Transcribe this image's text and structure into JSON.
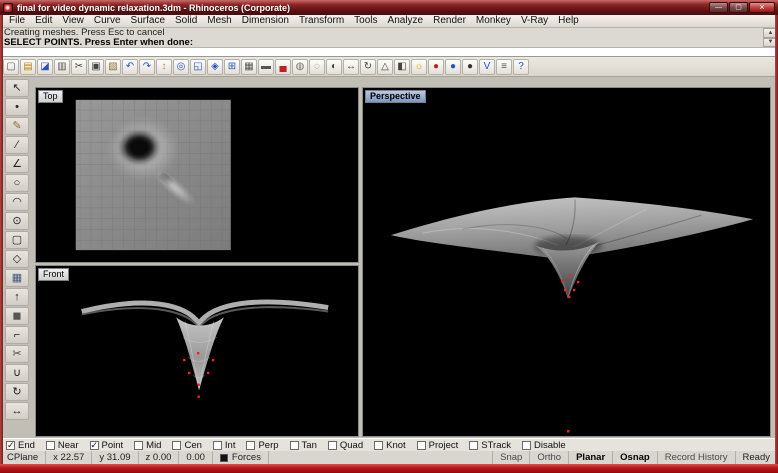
{
  "window": {
    "title": "final for video dynamic relaxation.3dm - Rhinoceros (Corporate)"
  },
  "colors": {
    "title_bar": "#6f1517",
    "frame_red": "#c01818",
    "active_viewport_label": "#8fa7cd",
    "viewport_background": "#000000",
    "control_point_red": "#ff2020"
  },
  "menu": {
    "items": [
      "File",
      "Edit",
      "View",
      "Curve",
      "Surface",
      "Solid",
      "Mesh",
      "Dimension",
      "Transform",
      "Tools",
      "Analyze",
      "Render",
      "Monkey",
      "V-Ray",
      "Help"
    ]
  },
  "command": {
    "history_line_1": "Creating meshes.  Press Esc to cancel",
    "history_line_2": "SELECT POINTS. Press Enter when done:",
    "input_value": ""
  },
  "toolbar": {
    "icons": [
      {
        "name": "new-file-icon",
        "glyph": "▢",
        "color": "#555555"
      },
      {
        "name": "open-file-icon",
        "glyph": "▤",
        "color": "#b8860b"
      },
      {
        "name": "save-icon",
        "glyph": "◪",
        "color": "#2a52be"
      },
      {
        "name": "print-icon",
        "glyph": "▥",
        "color": "#555555"
      },
      {
        "name": "cut-icon",
        "glyph": "✂",
        "color": "#444444"
      },
      {
        "name": "copy-icon",
        "glyph": "▣",
        "color": "#444444"
      },
      {
        "name": "paste-icon",
        "glyph": "▧",
        "color": "#8a6d3b"
      },
      {
        "name": "undo-icon",
        "glyph": "↶",
        "color": "#2a52be"
      },
      {
        "name": "redo-icon",
        "glyph": "↷",
        "color": "#2a52be"
      },
      {
        "name": "pan-icon",
        "glyph": "↕",
        "color": "#c08a50"
      },
      {
        "name": "zoom-dynamic-icon",
        "glyph": "◎",
        "color": "#2a52be"
      },
      {
        "name": "zoom-window-icon",
        "glyph": "◱",
        "color": "#2a52be"
      },
      {
        "name": "zoom-extents-icon",
        "glyph": "◈",
        "color": "#2a52be"
      },
      {
        "name": "zoom-extents-all-icon",
        "glyph": "⊞",
        "color": "#2a52be"
      },
      {
        "name": "viewport-layout-icon",
        "glyph": "▦",
        "color": "#555555"
      },
      {
        "name": "named-views-icon",
        "glyph": "▬",
        "color": "#555555"
      },
      {
        "name": "render-car-icon",
        "glyph": "▄",
        "color": "#c02020"
      },
      {
        "name": "shaded-view-icon",
        "glyph": "◍",
        "color": "#707070"
      },
      {
        "name": "ghosted-view-icon",
        "glyph": "◌",
        "color": "#707070"
      },
      {
        "name": "render-preview-icon",
        "glyph": "◐",
        "color": "#444444"
      },
      {
        "name": "move-icon",
        "glyph": "↔",
        "color": "#444444"
      },
      {
        "name": "rotate-icon",
        "glyph": "↻",
        "color": "#444444"
      },
      {
        "name": "scale-icon",
        "glyph": "△",
        "color": "#444444"
      },
      {
        "name": "mirror-icon",
        "glyph": "◧",
        "color": "#444444"
      },
      {
        "name": "light-icon",
        "glyph": "☼",
        "color": "#d9a800"
      },
      {
        "name": "material-red-icon",
        "glyph": "●",
        "color": "#c22424"
      },
      {
        "name": "material-blue-icon",
        "glyph": "●",
        "color": "#2450c2"
      },
      {
        "name": "material-dark-icon",
        "glyph": "●",
        "color": "#333333"
      },
      {
        "name": "vray-options-icon",
        "glyph": "V",
        "color": "#2450c2"
      },
      {
        "name": "properties-icon",
        "glyph": "≡",
        "color": "#555555"
      },
      {
        "name": "help-icon",
        "glyph": "?",
        "color": "#2450c2"
      }
    ]
  },
  "side_toolbar": {
    "icons": [
      {
        "name": "select-arrow-icon",
        "glyph": "↖",
        "color": "#222222"
      },
      {
        "name": "point-icon",
        "glyph": "•",
        "color": "#222222"
      },
      {
        "name": "curve-pencil-icon",
        "glyph": "✎",
        "color": "#8a6d3b"
      },
      {
        "name": "line-icon",
        "glyph": "∕",
        "color": "#222222"
      },
      {
        "name": "polyline-icon",
        "glyph": "∠",
        "color": "#222222"
      },
      {
        "name": "circle-icon",
        "glyph": "○",
        "color": "#222222"
      },
      {
        "name": "arc-icon",
        "glyph": "◠",
        "color": "#222222"
      },
      {
        "name": "ellipse-icon",
        "glyph": "⊙",
        "color": "#222222"
      },
      {
        "name": "rectangle-icon",
        "glyph": "▢",
        "color": "#222222"
      },
      {
        "name": "polygon-icon",
        "glyph": "◇",
        "color": "#222222"
      },
      {
        "name": "surface-icon",
        "glyph": "▦",
        "color": "#44557a"
      },
      {
        "name": "extrude-icon",
        "glyph": "↑",
        "color": "#222222"
      },
      {
        "name": "solid-box-icon",
        "glyph": "◼",
        "color": "#555555"
      },
      {
        "name": "fillet-icon",
        "glyph": "⌐",
        "color": "#222222"
      },
      {
        "name": "trim-icon",
        "glyph": "✂",
        "color": "#444444"
      },
      {
        "name": "join-icon",
        "glyph": "∪",
        "color": "#222222"
      },
      {
        "name": "transform-icon",
        "glyph": "↻",
        "color": "#222222"
      },
      {
        "name": "dimension-icon",
        "glyph": "↔",
        "color": "#222222"
      }
    ]
  },
  "viewports": {
    "top": {
      "label": "Top"
    },
    "front": {
      "label": "Front"
    },
    "perspective": {
      "label": "Perspective",
      "active": true
    }
  },
  "osnap": {
    "items": [
      {
        "name": "osnap-end",
        "label": "End",
        "checked": true
      },
      {
        "name": "osnap-near",
        "label": "Near",
        "checked": false
      },
      {
        "name": "osnap-point",
        "label": "Point",
        "checked": true
      },
      {
        "name": "osnap-mid",
        "label": "Mid",
        "checked": false
      },
      {
        "name": "osnap-cen",
        "label": "Cen",
        "checked": false
      },
      {
        "name": "osnap-int",
        "label": "Int",
        "checked": false
      },
      {
        "name": "osnap-perp",
        "label": "Perp",
        "checked": false
      },
      {
        "name": "osnap-tan",
        "label": "Tan",
        "checked": false
      },
      {
        "name": "osnap-quad",
        "label": "Quad",
        "checked": false
      },
      {
        "name": "osnap-knot",
        "label": "Knot",
        "checked": false
      },
      {
        "name": "osnap-project",
        "label": "Project",
        "checked": false
      },
      {
        "name": "osnap-strack",
        "label": "STrack",
        "checked": false
      },
      {
        "name": "osnap-disable",
        "label": "Disable",
        "checked": false
      }
    ]
  },
  "status_bar": {
    "cplane": "CPlane",
    "x": "x 22.57",
    "y": "y 31.09",
    "z": "z 0.00",
    "delta": "0.00",
    "layer": "Forces",
    "toggles": [
      {
        "name": "status-snap",
        "label": "Snap",
        "active": false
      },
      {
        "name": "status-ortho",
        "label": "Ortho",
        "active": false
      },
      {
        "name": "status-planar",
        "label": "Planar",
        "active": true
      },
      {
        "name": "status-osnap",
        "label": "Osnap",
        "active": true
      },
      {
        "name": "status-record-history",
        "label": "Record History",
        "active": false
      }
    ],
    "ready": "Ready"
  }
}
